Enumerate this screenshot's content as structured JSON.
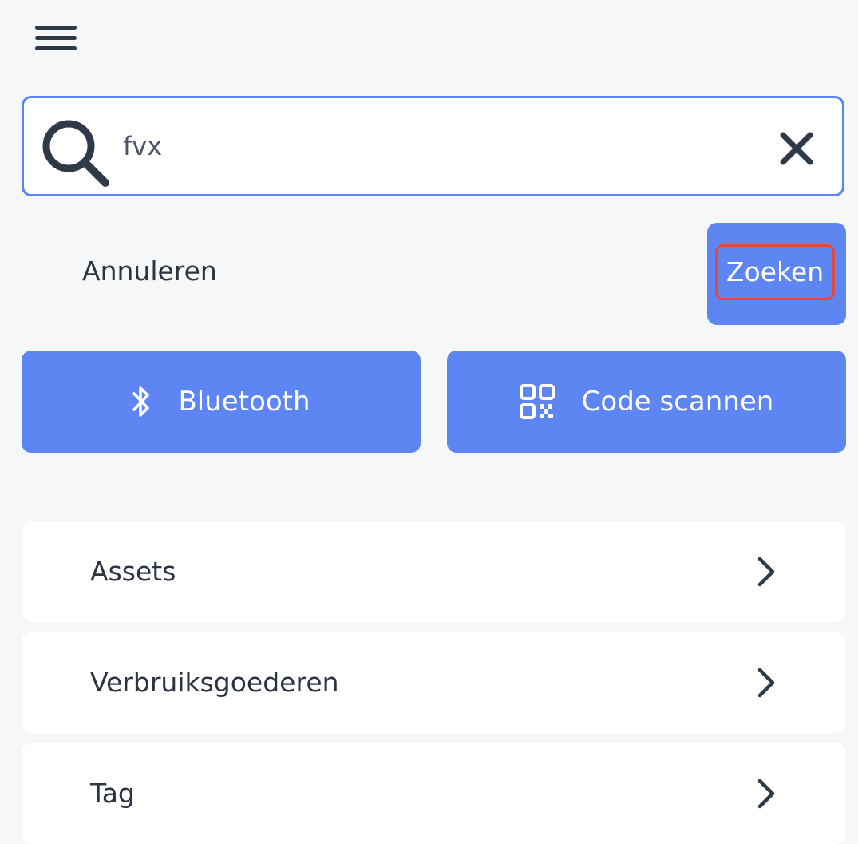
{
  "header": {
    "menu_icon": "hamburger-menu-icon"
  },
  "search": {
    "value": "fvx",
    "icon": "search-icon",
    "clear_icon": "close-icon"
  },
  "actions": {
    "cancel_label": "Annuleren",
    "search_label": "Zoeken",
    "bluetooth_label": "Bluetooth",
    "bluetooth_icon": "bluetooth-icon",
    "scan_label": "Code scannen",
    "scan_icon": "qr-code-icon"
  },
  "categories": [
    {
      "label": "Assets",
      "icon": "chevron-right-icon"
    },
    {
      "label": "Verbruiksgoederen",
      "icon": "chevron-right-icon"
    },
    {
      "label": "Tag",
      "icon": "chevron-right-icon"
    }
  ],
  "colors": {
    "accent": "#5d86f2",
    "background": "#f6f7f9",
    "highlight": "#e0473e"
  }
}
